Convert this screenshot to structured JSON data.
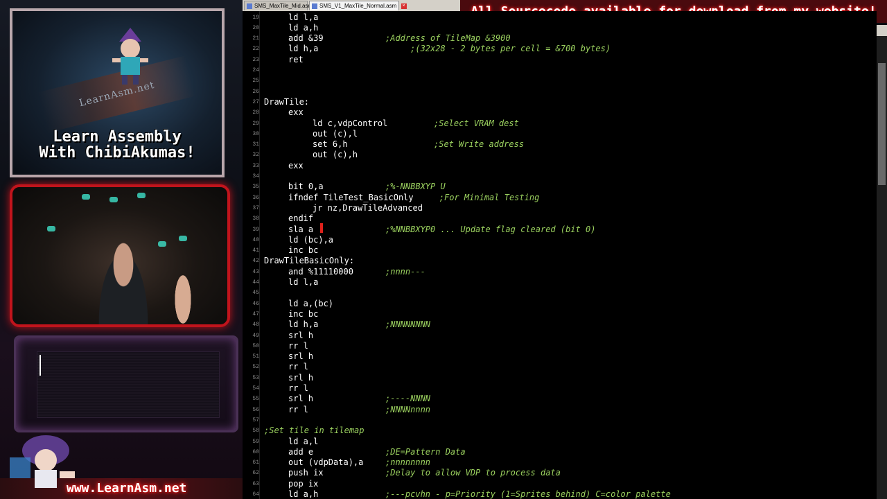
{
  "tabs": [
    {
      "label": "SMS_MaxTile_Mid.asm"
    },
    {
      "label": "SMS_V1_MaxTile_Normal.asm"
    }
  ],
  "banner": "All Sourcecode available for download from my website!",
  "overlay": {
    "logo_site": "LearnAsm.net",
    "logo_title_line1": "Learn Assembly",
    "logo_title_line2": "With ChibiAkumas!",
    "footer_url": "www.LearnAsm.net"
  },
  "code_lines": [
    {
      "n": "19",
      "code": "ld l,a",
      "indent": 1,
      "comment": ""
    },
    {
      "n": "20",
      "code": "ld a,h",
      "indent": 1,
      "comment": ""
    },
    {
      "n": "21",
      "code": "add &39",
      "indent": 1,
      "comment": ";Address of TileMap &3900"
    },
    {
      "n": "22",
      "code": "ld h,a",
      "indent": 1,
      "comment": "     ;(32x28 - 2 bytes per cell = &700 bytes)"
    },
    {
      "n": "23",
      "code": "ret",
      "indent": 1,
      "comment": ""
    },
    {
      "n": "24",
      "code": "",
      "indent": 0,
      "comment": ""
    },
    {
      "n": "25",
      "code": "",
      "indent": 0,
      "comment": ""
    },
    {
      "n": "26",
      "code": "",
      "indent": 0,
      "comment": ""
    },
    {
      "n": "27",
      "code": "DrawTile:",
      "indent": 0,
      "comment": ""
    },
    {
      "n": "28",
      "code": "exx",
      "indent": 1,
      "comment": ""
    },
    {
      "n": "29",
      "code": "ld c,vdpControl",
      "indent": 2,
      "comment": ";Select VRAM dest"
    },
    {
      "n": "30",
      "code": "out (c),l",
      "indent": 2,
      "comment": ""
    },
    {
      "n": "31",
      "code": "set 6,h",
      "indent": 2,
      "comment": ";Set Write address"
    },
    {
      "n": "32",
      "code": "out (c),h",
      "indent": 2,
      "comment": ""
    },
    {
      "n": "33",
      "code": "exx",
      "indent": 1,
      "comment": ""
    },
    {
      "n": "34",
      "code": "",
      "indent": 0,
      "comment": ""
    },
    {
      "n": "35",
      "code": "bit 0,a",
      "indent": 1,
      "comment": ";%-NNBBXYP U"
    },
    {
      "n": "36",
      "code": "ifndef TileTest_BasicOnly",
      "indent": 1,
      "comment": "        ;For Minimal Testing"
    },
    {
      "n": "37",
      "code": "jr nz,DrawTileAdvanced",
      "indent": 2,
      "comment": ""
    },
    {
      "n": "38",
      "code": "endif",
      "indent": 1,
      "comment": ""
    },
    {
      "n": "39",
      "code": "sla a",
      "indent": 1,
      "comment": ";%NNBBXYP0 ... Update flag cleared (bit 0)"
    },
    {
      "n": "40",
      "code": "ld (bc),a",
      "indent": 1,
      "comment": ""
    },
    {
      "n": "41",
      "code": "inc bc",
      "indent": 1,
      "comment": ""
    },
    {
      "n": "42",
      "code": "DrawTileBasicOnly:",
      "indent": 0,
      "comment": ""
    },
    {
      "n": "43",
      "code": "and %11110000",
      "indent": 1,
      "comment": ";nnnn---"
    },
    {
      "n": "44",
      "code": "ld l,a",
      "indent": 1,
      "comment": ""
    },
    {
      "n": "45",
      "code": "",
      "indent": 0,
      "comment": ""
    },
    {
      "n": "46",
      "code": "ld a,(bc)",
      "indent": 1,
      "comment": ""
    },
    {
      "n": "47",
      "code": "inc bc",
      "indent": 1,
      "comment": ""
    },
    {
      "n": "48",
      "code": "ld h,a",
      "indent": 1,
      "comment": ";NNNNNNNN"
    },
    {
      "n": "49",
      "code": "srl h",
      "indent": 1,
      "comment": ""
    },
    {
      "n": "50",
      "code": "rr l",
      "indent": 1,
      "comment": ""
    },
    {
      "n": "51",
      "code": "srl h",
      "indent": 1,
      "comment": ""
    },
    {
      "n": "52",
      "code": "rr l",
      "indent": 1,
      "comment": ""
    },
    {
      "n": "53",
      "code": "srl h",
      "indent": 1,
      "comment": ""
    },
    {
      "n": "54",
      "code": "rr l",
      "indent": 1,
      "comment": ""
    },
    {
      "n": "55",
      "code": "srl h",
      "indent": 1,
      "comment": ";----NNNN"
    },
    {
      "n": "56",
      "code": "rr l",
      "indent": 1,
      "comment": ";NNNNnnnn"
    },
    {
      "n": "57",
      "code": "",
      "indent": 0,
      "comment": ""
    },
    {
      "n": "58",
      "code": "",
      "indent": 0,
      "comment": ";Set tile in tilemap"
    },
    {
      "n": "59",
      "code": "ld a,l",
      "indent": 1,
      "comment": ""
    },
    {
      "n": "60",
      "code": "add e",
      "indent": 1,
      "comment": ";DE=Pattern Data"
    },
    {
      "n": "61",
      "code": "out (vdpData),a",
      "indent": 1,
      "comment": ";nnnnnnnn"
    },
    {
      "n": "62",
      "code": "push ix",
      "indent": 1,
      "comment": ";Delay to allow VDP to process data"
    },
    {
      "n": "63",
      "code": "pop ix",
      "indent": 1,
      "comment": ""
    },
    {
      "n": "64",
      "code": "ld a,h",
      "indent": 1,
      "comment": ";---pcvhn - p=Priority (1=Sprites behind) C=color palette"
    }
  ]
}
